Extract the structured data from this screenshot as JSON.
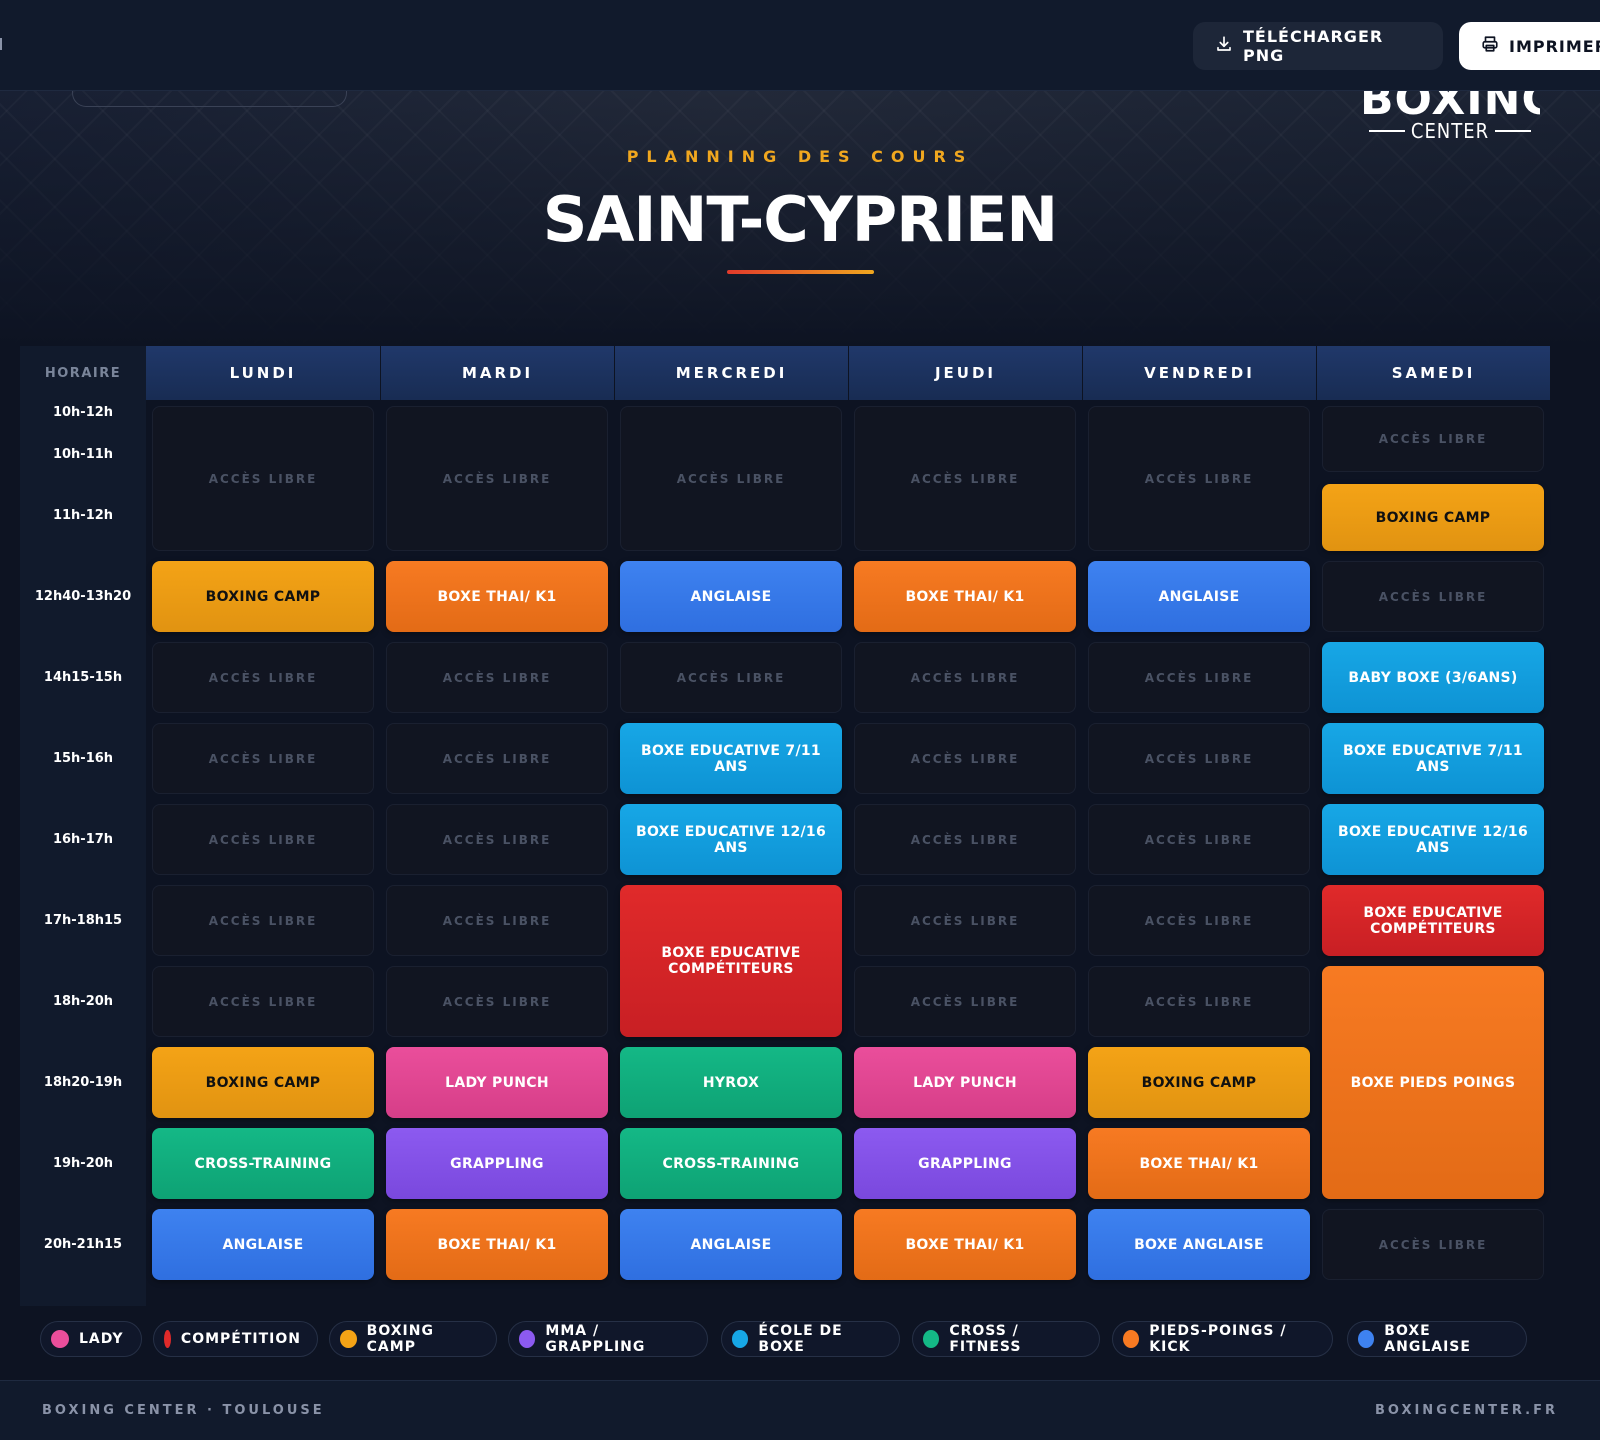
{
  "toolbar": {
    "download_label": "TÉLÉCHARGER PNG",
    "print_label": "IMPRIMER"
  },
  "logo": {
    "top_text": "BOXING",
    "sub_text": "CENTER"
  },
  "hero": {
    "kicker": "PLANNING DES COURS",
    "title": "SAINT-CYPRIEN"
  },
  "table": {
    "time_header": "HORAIRE",
    "days": [
      "LUNDI",
      "MARDI",
      "MERCREDI",
      "JEUDI",
      "VENDREDI",
      "SAMEDI"
    ],
    "time_slots": [
      "10h-12h",
      "10h-11h",
      "11h-12h",
      "12h40-13h20",
      "14h15-15h",
      "15h-16h",
      "16h-17h",
      "17h-18h15",
      "18h-20h",
      "18h20-19h",
      "19h-20h",
      "20h-21h15"
    ],
    "sessions": [
      {
        "day": 0,
        "row_start": 0,
        "row_end": 2,
        "label": "ACCÈS LIBRE",
        "type": "libre"
      },
      {
        "day": 1,
        "row_start": 0,
        "row_end": 2,
        "label": "ACCÈS LIBRE",
        "type": "libre"
      },
      {
        "day": 2,
        "row_start": 0,
        "row_end": 2,
        "label": "ACCÈS LIBRE",
        "type": "libre"
      },
      {
        "day": 3,
        "row_start": 0,
        "row_end": 2,
        "label": "ACCÈS LIBRE",
        "type": "libre"
      },
      {
        "day": 4,
        "row_start": 0,
        "row_end": 2,
        "label": "ACCÈS LIBRE",
        "type": "libre"
      },
      {
        "day": 5,
        "row_start": 0,
        "row_end": 1,
        "label": "ACCÈS LIBRE",
        "type": "libre"
      },
      {
        "day": 5,
        "row_start": 2,
        "row_end": 2,
        "label": "BOXING CAMP",
        "type": "gold"
      },
      {
        "day": 0,
        "row_start": 3,
        "row_end": 3,
        "label": "BOXING CAMP",
        "type": "gold"
      },
      {
        "day": 1,
        "row_start": 3,
        "row_end": 3,
        "label": "BOXE THAI/ K1",
        "type": "orange"
      },
      {
        "day": 2,
        "row_start": 3,
        "row_end": 3,
        "label": "ANGLAISE",
        "type": "blue"
      },
      {
        "day": 3,
        "row_start": 3,
        "row_end": 3,
        "label": "BOXE THAI/ K1",
        "type": "orange"
      },
      {
        "day": 4,
        "row_start": 3,
        "row_end": 3,
        "label": "ANGLAISE",
        "type": "blue"
      },
      {
        "day": 5,
        "row_start": 3,
        "row_end": 3,
        "label": "ACCÈS LIBRE",
        "type": "libre"
      },
      {
        "day": 0,
        "row_start": 4,
        "row_end": 4,
        "label": "ACCÈS LIBRE",
        "type": "libre"
      },
      {
        "day": 1,
        "row_start": 4,
        "row_end": 4,
        "label": "ACCÈS LIBRE",
        "type": "libre"
      },
      {
        "day": 2,
        "row_start": 4,
        "row_end": 4,
        "label": "ACCÈS LIBRE",
        "type": "libre"
      },
      {
        "day": 3,
        "row_start": 4,
        "row_end": 4,
        "label": "ACCÈS LIBRE",
        "type": "libre"
      },
      {
        "day": 4,
        "row_start": 4,
        "row_end": 4,
        "label": "ACCÈS LIBRE",
        "type": "libre"
      },
      {
        "day": 5,
        "row_start": 4,
        "row_end": 4,
        "label": "BABY BOXE (3/6ANS)",
        "type": "cyan"
      },
      {
        "day": 0,
        "row_start": 5,
        "row_end": 5,
        "label": "ACCÈS LIBRE",
        "type": "libre"
      },
      {
        "day": 1,
        "row_start": 5,
        "row_end": 5,
        "label": "ACCÈS LIBRE",
        "type": "libre"
      },
      {
        "day": 2,
        "row_start": 5,
        "row_end": 5,
        "label": "BOXE EDUCATIVE 7/11 ANS",
        "type": "cyan"
      },
      {
        "day": 3,
        "row_start": 5,
        "row_end": 5,
        "label": "ACCÈS LIBRE",
        "type": "libre"
      },
      {
        "day": 4,
        "row_start": 5,
        "row_end": 5,
        "label": "ACCÈS LIBRE",
        "type": "libre"
      },
      {
        "day": 5,
        "row_start": 5,
        "row_end": 5,
        "label": "BOXE EDUCATIVE 7/11 ANS",
        "type": "cyan"
      },
      {
        "day": 0,
        "row_start": 6,
        "row_end": 6,
        "label": "ACCÈS LIBRE",
        "type": "libre"
      },
      {
        "day": 1,
        "row_start": 6,
        "row_end": 6,
        "label": "ACCÈS LIBRE",
        "type": "libre"
      },
      {
        "day": 2,
        "row_start": 6,
        "row_end": 6,
        "label": "BOXE EDUCATIVE 12/16 ANS",
        "type": "cyan"
      },
      {
        "day": 3,
        "row_start": 6,
        "row_end": 6,
        "label": "ACCÈS LIBRE",
        "type": "libre"
      },
      {
        "day": 4,
        "row_start": 6,
        "row_end": 6,
        "label": "ACCÈS LIBRE",
        "type": "libre"
      },
      {
        "day": 5,
        "row_start": 6,
        "row_end": 6,
        "label": "BOXE EDUCATIVE 12/16 ANS",
        "type": "cyan"
      },
      {
        "day": 0,
        "row_start": 7,
        "row_end": 7,
        "label": "ACCÈS LIBRE",
        "type": "libre"
      },
      {
        "day": 1,
        "row_start": 7,
        "row_end": 7,
        "label": "ACCÈS LIBRE",
        "type": "libre"
      },
      {
        "day": 2,
        "row_start": 7,
        "row_end": 8,
        "label": "BOXE EDUCATIVE COMPÉTITEURS",
        "type": "red"
      },
      {
        "day": 3,
        "row_start": 7,
        "row_end": 7,
        "label": "ACCÈS LIBRE",
        "type": "libre"
      },
      {
        "day": 4,
        "row_start": 7,
        "row_end": 7,
        "label": "ACCÈS LIBRE",
        "type": "libre"
      },
      {
        "day": 5,
        "row_start": 7,
        "row_end": 7,
        "label": "BOXE EDUCATIVE COMPÉTITEURS",
        "type": "red"
      },
      {
        "day": 0,
        "row_start": 8,
        "row_end": 8,
        "label": "ACCÈS LIBRE",
        "type": "libre"
      },
      {
        "day": 1,
        "row_start": 8,
        "row_end": 8,
        "label": "ACCÈS LIBRE",
        "type": "libre"
      },
      {
        "day": 3,
        "row_start": 8,
        "row_end": 8,
        "label": "ACCÈS LIBRE",
        "type": "libre"
      },
      {
        "day": 4,
        "row_start": 8,
        "row_end": 8,
        "label": "ACCÈS LIBRE",
        "type": "libre"
      },
      {
        "day": 5,
        "row_start": 8,
        "row_end": 10,
        "label": "BOXE PIEDS POINGS",
        "type": "orange"
      },
      {
        "day": 0,
        "row_start": 9,
        "row_end": 9,
        "label": "BOXING CAMP",
        "type": "gold"
      },
      {
        "day": 1,
        "row_start": 9,
        "row_end": 9,
        "label": "LADY PUNCH",
        "type": "pink"
      },
      {
        "day": 2,
        "row_start": 9,
        "row_end": 9,
        "label": "HYROX",
        "type": "green"
      },
      {
        "day": 3,
        "row_start": 9,
        "row_end": 9,
        "label": "LADY PUNCH",
        "type": "pink"
      },
      {
        "day": 4,
        "row_start": 9,
        "row_end": 9,
        "label": "BOXING CAMP",
        "type": "gold"
      },
      {
        "day": 0,
        "row_start": 10,
        "row_end": 10,
        "label": "CROSS-TRAINING",
        "type": "green"
      },
      {
        "day": 1,
        "row_start": 10,
        "row_end": 10,
        "label": "GRAPPLING",
        "type": "purple"
      },
      {
        "day": 2,
        "row_start": 10,
        "row_end": 10,
        "label": "CROSS-TRAINING",
        "type": "green"
      },
      {
        "day": 3,
        "row_start": 10,
        "row_end": 10,
        "label": "GRAPPLING",
        "type": "purple"
      },
      {
        "day": 4,
        "row_start": 10,
        "row_end": 10,
        "label": "BOXE THAI/ K1",
        "type": "orange"
      },
      {
        "day": 0,
        "row_start": 11,
        "row_end": 11,
        "label": "ANGLAISE",
        "type": "blue"
      },
      {
        "day": 1,
        "row_start": 11,
        "row_end": 11,
        "label": "BOXE THAI/ K1",
        "type": "orange"
      },
      {
        "day": 2,
        "row_start": 11,
        "row_end": 11,
        "label": "ANGLAISE",
        "type": "blue"
      },
      {
        "day": 3,
        "row_start": 11,
        "row_end": 11,
        "label": "BOXE THAI/ K1",
        "type": "orange"
      },
      {
        "day": 4,
        "row_start": 11,
        "row_end": 11,
        "label": "BOXE ANGLAISE",
        "type": "blue"
      },
      {
        "day": 5,
        "row_start": 11,
        "row_end": 11,
        "label": "ACCÈS LIBRE",
        "type": "libre"
      }
    ]
  },
  "legend": [
    {
      "label": "LADY",
      "color": "#ea4e9b"
    },
    {
      "label": "COMPÉTITION",
      "color": "#e02a2a"
    },
    {
      "label": "BOXING CAMP",
      "color": "#f4a316"
    },
    {
      "label": "MMA / GRAPPLING",
      "color": "#8c5af0"
    },
    {
      "label": "ÉCOLE DE BOXE",
      "color": "#17a7e6"
    },
    {
      "label": "CROSS / FITNESS",
      "color": "#14b886"
    },
    {
      "label": "PIEDS-POINGS / KICK",
      "color": "#f77a22"
    },
    {
      "label": "BOXE ANGLAISE",
      "color": "#3e82f0"
    }
  ],
  "footer": {
    "left": "BOXING CENTER · TOULOUSE",
    "right": "BOXINGCENTER.FR"
  }
}
